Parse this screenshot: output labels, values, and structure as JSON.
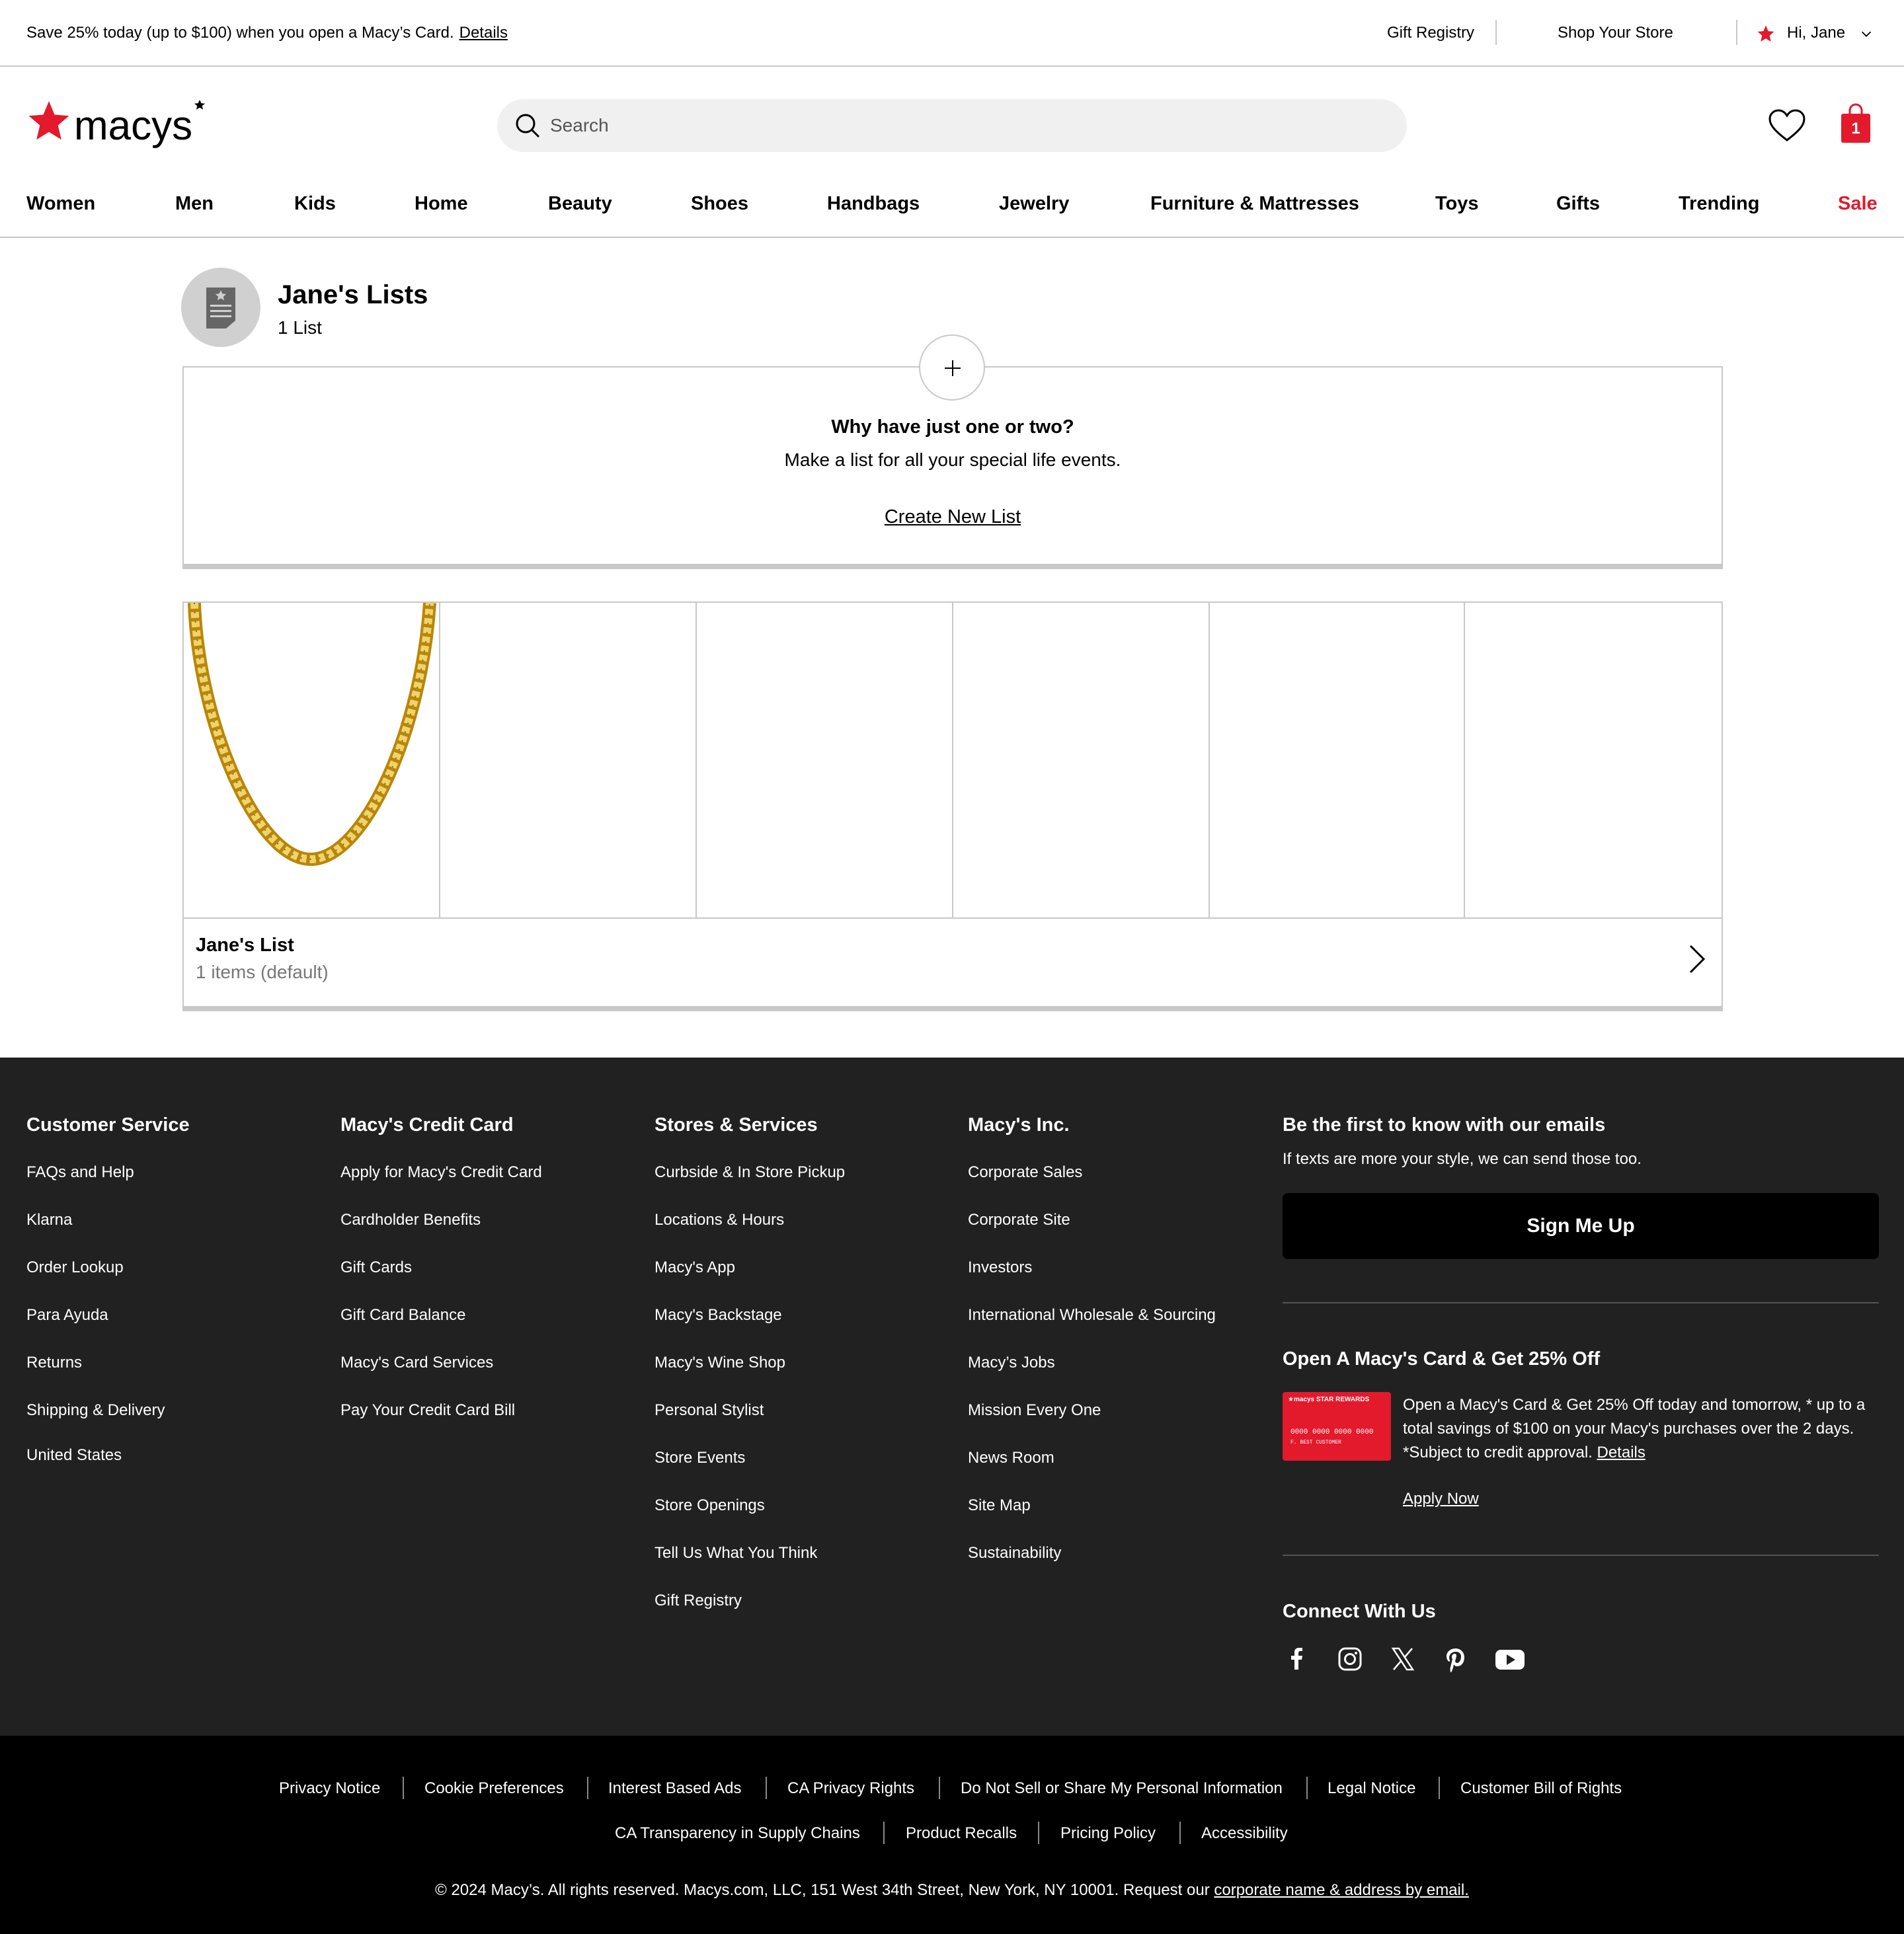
{
  "promo": {
    "text": "Save 25% today (up to $100) when you open a Macy’s Card.",
    "link": "Details"
  },
  "utility": {
    "gift_registry": "Gift Registry",
    "shop_store": "Shop Your Store",
    "greeting": "Hi, Jane"
  },
  "header": {
    "logo_text": "macys",
    "search_placeholder": "Search",
    "bag_count": "1"
  },
  "nav": [
    "Women",
    "Men",
    "Kids",
    "Home",
    "Beauty",
    "Shoes",
    "Handbags",
    "Jewelry",
    "Furniture & Mattresses",
    "Toys",
    "Gifts",
    "Trending",
    "Sale"
  ],
  "lists_page": {
    "title": "Jane's Lists",
    "count": "1 List",
    "create_heading": "Why have just one or two?",
    "create_sub": "Make a list for all your special life events.",
    "create_link": "Create New List"
  },
  "list_card": {
    "name": "Jane's List",
    "items": "1 items (default)"
  },
  "footer": {
    "customer_service": {
      "heading": "Customer Service",
      "links": [
        "FAQs and Help",
        "Klarna",
        "Order Lookup",
        "Para Ayuda",
        "Returns",
        "Shipping & Delivery"
      ],
      "country": "United States"
    },
    "credit_card": {
      "heading": "Macy's Credit Card",
      "links": [
        "Apply for Macy's Credit Card",
        "Cardholder Benefits",
        "Gift Cards",
        "Gift Card Balance",
        "Macy's Card Services",
        "Pay Your Credit Card Bill"
      ]
    },
    "stores": {
      "heading": "Stores & Services",
      "links": [
        "Curbside & In Store Pickup",
        "Locations & Hours",
        "Macy's App",
        "Macy's Backstage",
        "Macy's Wine Shop",
        "Personal Stylist",
        "Store Events",
        "Store Openings",
        "Tell Us What You Think",
        "Gift Registry"
      ]
    },
    "inc": {
      "heading": "Macy's Inc.",
      "links": [
        "Corporate Sales",
        "Corporate Site",
        "Investors",
        "International Wholesale & Sourcing",
        "Macy’s Jobs",
        "Mission Every One",
        "News Room",
        "Site Map",
        "Sustainability"
      ]
    },
    "email": {
      "heading": "Be the first to know with our emails",
      "sub": "If texts are more your style, we can send those too.",
      "button": "Sign Me Up"
    },
    "card_offer": {
      "heading": "Open A Macy's Card & Get 25% Off",
      "text": "Open a Macy's Card & Get 25% Off today and tomorrow, * up to a total savings of $100 on your Macy's purchases over the 2 days. *Subject to credit approval.",
      "details": "Details",
      "apply": "Apply Now",
      "card_brand": "★macys STAR REWARDS",
      "card_number": "0000 0000 0000 0000",
      "card_holder": "F. BEST CUSTOMER"
    },
    "connect": "Connect With Us"
  },
  "legal": {
    "row1": [
      "Privacy Notice",
      "Cookie Preferences",
      "Interest Based Ads",
      "CA Privacy Rights",
      "Do Not Sell or Share My Personal Information",
      "Legal Notice",
      "Customer Bill of Rights"
    ],
    "row2": [
      "CA Transparency in Supply Chains",
      "Product Recalls",
      "Pricing Policy",
      "Accessibility"
    ],
    "copyright": "© 2024 Macy’s. All rights reserved. Macys.com, LLC, 151 West 34th Street, New York, NY 10001. Request our",
    "copyright_link": "corporate name & address by email."
  },
  "colors": {
    "brand_red": "#e21a2c",
    "footer_bg": "#212121",
    "legal_bg": "#000000"
  }
}
